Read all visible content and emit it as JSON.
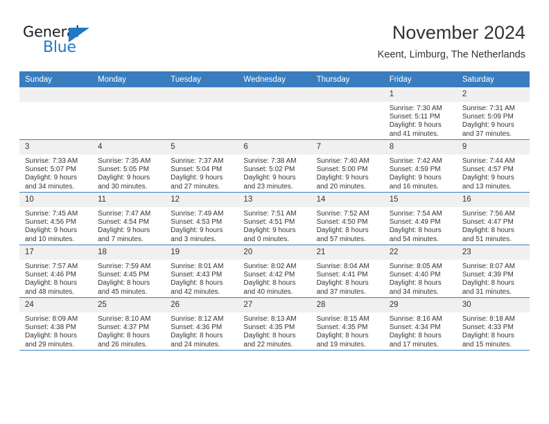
{
  "brand": {
    "name_part1": "General",
    "name_part2": "Blue",
    "accent_color": "#1e7ac4"
  },
  "header": {
    "title": "November 2024",
    "subtitle": "Keent, Limburg, The Netherlands"
  },
  "theme": {
    "header_row_bg": "#3a7dbf",
    "daynum_bg": "#f0f0f0",
    "grid_line": "#3a7dbf"
  },
  "weekday_headers": [
    "Sunday",
    "Monday",
    "Tuesday",
    "Wednesday",
    "Thursday",
    "Friday",
    "Saturday"
  ],
  "weeks": [
    [
      {
        "day": "",
        "sunrise": "",
        "sunset": "",
        "daylight_line1": "",
        "daylight_line2": ""
      },
      {
        "day": "",
        "sunrise": "",
        "sunset": "",
        "daylight_line1": "",
        "daylight_line2": ""
      },
      {
        "day": "",
        "sunrise": "",
        "sunset": "",
        "daylight_line1": "",
        "daylight_line2": ""
      },
      {
        "day": "",
        "sunrise": "",
        "sunset": "",
        "daylight_line1": "",
        "daylight_line2": ""
      },
      {
        "day": "",
        "sunrise": "",
        "sunset": "",
        "daylight_line1": "",
        "daylight_line2": ""
      },
      {
        "day": "1",
        "sunrise": "Sunrise: 7:30 AM",
        "sunset": "Sunset: 5:11 PM",
        "daylight_line1": "Daylight: 9 hours",
        "daylight_line2": "and 41 minutes."
      },
      {
        "day": "2",
        "sunrise": "Sunrise: 7:31 AM",
        "sunset": "Sunset: 5:09 PM",
        "daylight_line1": "Daylight: 9 hours",
        "daylight_line2": "and 37 minutes."
      }
    ],
    [
      {
        "day": "3",
        "sunrise": "Sunrise: 7:33 AM",
        "sunset": "Sunset: 5:07 PM",
        "daylight_line1": "Daylight: 9 hours",
        "daylight_line2": "and 34 minutes."
      },
      {
        "day": "4",
        "sunrise": "Sunrise: 7:35 AM",
        "sunset": "Sunset: 5:05 PM",
        "daylight_line1": "Daylight: 9 hours",
        "daylight_line2": "and 30 minutes."
      },
      {
        "day": "5",
        "sunrise": "Sunrise: 7:37 AM",
        "sunset": "Sunset: 5:04 PM",
        "daylight_line1": "Daylight: 9 hours",
        "daylight_line2": "and 27 minutes."
      },
      {
        "day": "6",
        "sunrise": "Sunrise: 7:38 AM",
        "sunset": "Sunset: 5:02 PM",
        "daylight_line1": "Daylight: 9 hours",
        "daylight_line2": "and 23 minutes."
      },
      {
        "day": "7",
        "sunrise": "Sunrise: 7:40 AM",
        "sunset": "Sunset: 5:00 PM",
        "daylight_line1": "Daylight: 9 hours",
        "daylight_line2": "and 20 minutes."
      },
      {
        "day": "8",
        "sunrise": "Sunrise: 7:42 AM",
        "sunset": "Sunset: 4:59 PM",
        "daylight_line1": "Daylight: 9 hours",
        "daylight_line2": "and 16 minutes."
      },
      {
        "day": "9",
        "sunrise": "Sunrise: 7:44 AM",
        "sunset": "Sunset: 4:57 PM",
        "daylight_line1": "Daylight: 9 hours",
        "daylight_line2": "and 13 minutes."
      }
    ],
    [
      {
        "day": "10",
        "sunrise": "Sunrise: 7:45 AM",
        "sunset": "Sunset: 4:56 PM",
        "daylight_line1": "Daylight: 9 hours",
        "daylight_line2": "and 10 minutes."
      },
      {
        "day": "11",
        "sunrise": "Sunrise: 7:47 AM",
        "sunset": "Sunset: 4:54 PM",
        "daylight_line1": "Daylight: 9 hours",
        "daylight_line2": "and 7 minutes."
      },
      {
        "day": "12",
        "sunrise": "Sunrise: 7:49 AM",
        "sunset": "Sunset: 4:53 PM",
        "daylight_line1": "Daylight: 9 hours",
        "daylight_line2": "and 3 minutes."
      },
      {
        "day": "13",
        "sunrise": "Sunrise: 7:51 AM",
        "sunset": "Sunset: 4:51 PM",
        "daylight_line1": "Daylight: 9 hours",
        "daylight_line2": "and 0 minutes."
      },
      {
        "day": "14",
        "sunrise": "Sunrise: 7:52 AM",
        "sunset": "Sunset: 4:50 PM",
        "daylight_line1": "Daylight: 8 hours",
        "daylight_line2": "and 57 minutes."
      },
      {
        "day": "15",
        "sunrise": "Sunrise: 7:54 AM",
        "sunset": "Sunset: 4:49 PM",
        "daylight_line1": "Daylight: 8 hours",
        "daylight_line2": "and 54 minutes."
      },
      {
        "day": "16",
        "sunrise": "Sunrise: 7:56 AM",
        "sunset": "Sunset: 4:47 PM",
        "daylight_line1": "Daylight: 8 hours",
        "daylight_line2": "and 51 minutes."
      }
    ],
    [
      {
        "day": "17",
        "sunrise": "Sunrise: 7:57 AM",
        "sunset": "Sunset: 4:46 PM",
        "daylight_line1": "Daylight: 8 hours",
        "daylight_line2": "and 48 minutes."
      },
      {
        "day": "18",
        "sunrise": "Sunrise: 7:59 AM",
        "sunset": "Sunset: 4:45 PM",
        "daylight_line1": "Daylight: 8 hours",
        "daylight_line2": "and 45 minutes."
      },
      {
        "day": "19",
        "sunrise": "Sunrise: 8:01 AM",
        "sunset": "Sunset: 4:43 PM",
        "daylight_line1": "Daylight: 8 hours",
        "daylight_line2": "and 42 minutes."
      },
      {
        "day": "20",
        "sunrise": "Sunrise: 8:02 AM",
        "sunset": "Sunset: 4:42 PM",
        "daylight_line1": "Daylight: 8 hours",
        "daylight_line2": "and 40 minutes."
      },
      {
        "day": "21",
        "sunrise": "Sunrise: 8:04 AM",
        "sunset": "Sunset: 4:41 PM",
        "daylight_line1": "Daylight: 8 hours",
        "daylight_line2": "and 37 minutes."
      },
      {
        "day": "22",
        "sunrise": "Sunrise: 8:05 AM",
        "sunset": "Sunset: 4:40 PM",
        "daylight_line1": "Daylight: 8 hours",
        "daylight_line2": "and 34 minutes."
      },
      {
        "day": "23",
        "sunrise": "Sunrise: 8:07 AM",
        "sunset": "Sunset: 4:39 PM",
        "daylight_line1": "Daylight: 8 hours",
        "daylight_line2": "and 31 minutes."
      }
    ],
    [
      {
        "day": "24",
        "sunrise": "Sunrise: 8:09 AM",
        "sunset": "Sunset: 4:38 PM",
        "daylight_line1": "Daylight: 8 hours",
        "daylight_line2": "and 29 minutes."
      },
      {
        "day": "25",
        "sunrise": "Sunrise: 8:10 AM",
        "sunset": "Sunset: 4:37 PM",
        "daylight_line1": "Daylight: 8 hours",
        "daylight_line2": "and 26 minutes."
      },
      {
        "day": "26",
        "sunrise": "Sunrise: 8:12 AM",
        "sunset": "Sunset: 4:36 PM",
        "daylight_line1": "Daylight: 8 hours",
        "daylight_line2": "and 24 minutes."
      },
      {
        "day": "27",
        "sunrise": "Sunrise: 8:13 AM",
        "sunset": "Sunset: 4:35 PM",
        "daylight_line1": "Daylight: 8 hours",
        "daylight_line2": "and 22 minutes."
      },
      {
        "day": "28",
        "sunrise": "Sunrise: 8:15 AM",
        "sunset": "Sunset: 4:35 PM",
        "daylight_line1": "Daylight: 8 hours",
        "daylight_line2": "and 19 minutes."
      },
      {
        "day": "29",
        "sunrise": "Sunrise: 8:16 AM",
        "sunset": "Sunset: 4:34 PM",
        "daylight_line1": "Daylight: 8 hours",
        "daylight_line2": "and 17 minutes."
      },
      {
        "day": "30",
        "sunrise": "Sunrise: 8:18 AM",
        "sunset": "Sunset: 4:33 PM",
        "daylight_line1": "Daylight: 8 hours",
        "daylight_line2": "and 15 minutes."
      }
    ]
  ]
}
